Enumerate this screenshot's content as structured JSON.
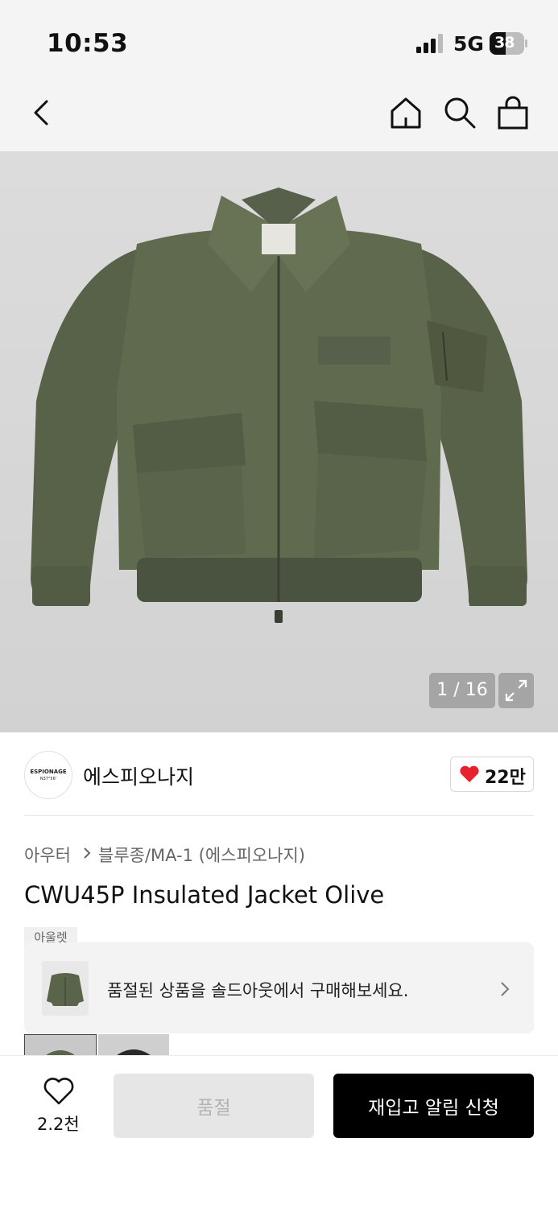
{
  "status_bar": {
    "time": "10:53",
    "network": "5G",
    "battery": "38"
  },
  "nav": {
    "icons": [
      "back-icon",
      "home-icon",
      "search-icon",
      "shopping-bag-icon"
    ]
  },
  "gallery": {
    "counter": "1 / 16",
    "expand_icon": "expand-icon",
    "product_image": "olive-insulated-jacket"
  },
  "brand": {
    "logo_line1": "ESPIONAGE",
    "logo_line2": "N37°56'",
    "name": "에스피오나지",
    "likes": "22만",
    "like_icon": "heart-filled-icon",
    "like_color": "#e8222d"
  },
  "breadcrumb": {
    "category": "아우터",
    "subcategory": "블루종/MA-1 (에스피오나지)"
  },
  "product": {
    "title": "CWU45P Insulated Jacket Olive",
    "outlet_tag": "아울렛"
  },
  "soldout_banner": {
    "text": "품절된 상품을 솔드아웃에서 구매해보세요."
  },
  "bottom_bar": {
    "wish_count": "2.2천",
    "soldout_label": "품절",
    "restock_label": "재입고 알림 신청"
  },
  "colors": {
    "accent_black": "#000000",
    "heart_red": "#e8222d",
    "jacket_olive": "#5a634a"
  }
}
